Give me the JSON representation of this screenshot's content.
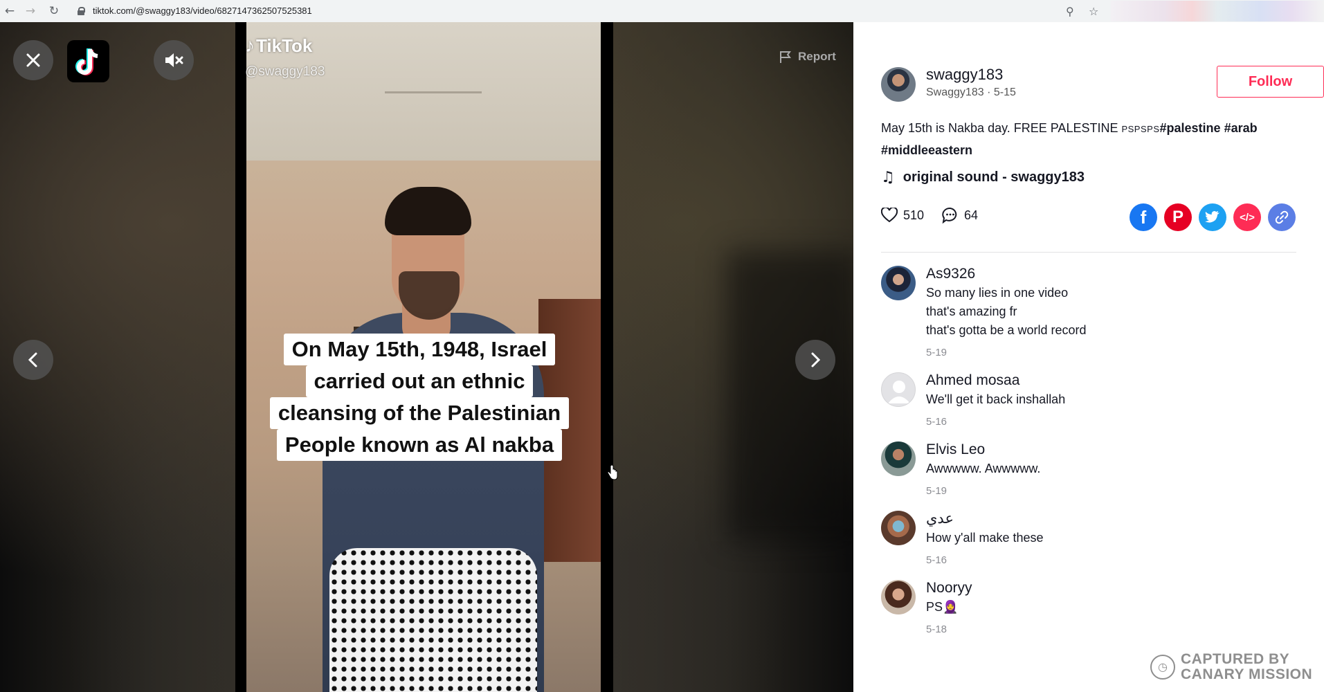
{
  "browser": {
    "url": "tiktok.com/@swaggy183/video/6827147362507525381"
  },
  "video": {
    "watermark_brand": "TikTok",
    "watermark_handle": "@swaggy183",
    "caption_lines": [
      "On May 15th, 1948,  Israel",
      "carried out an ethnic",
      "cleansing of the Palestinian",
      "People known as Al nakba"
    ],
    "report_label": "Report"
  },
  "post": {
    "author_username": "swaggy183",
    "author_meta": "Swaggy183 · 5-15",
    "follow_label": "Follow",
    "description_text": "May 15th is Nakba day. FREE PALESTINE ",
    "description_small": "PSPSPS",
    "hashtags": [
      "#palestine",
      "#arab",
      "#middleeastern"
    ],
    "sound": "original sound - swaggy183",
    "likes": "510",
    "comments_count": "64"
  },
  "share_colors": {
    "facebook": "#1877f2",
    "pinterest": "#e60023",
    "twitter": "#1da1f2",
    "embed": "#fe2c55",
    "link": "#5b7ee5"
  },
  "comments": [
    {
      "name": "As9326",
      "text": [
        "So many lies in one video",
        "that's amazing fr",
        "that's gotta be a world record"
      ],
      "date": "5-19"
    },
    {
      "name": "Ahmed mosaa",
      "text": [
        "We'll get it back inshallah"
      ],
      "date": "5-16"
    },
    {
      "name": "Elvis Leo",
      "text": [
        "Awwwww. Awwwww."
      ],
      "date": "5-19"
    },
    {
      "name": "عدي",
      "text": [
        "How y'all make these"
      ],
      "date": "5-16"
    },
    {
      "name": "Nooryy",
      "text": [
        "PS🧕"
      ],
      "date": "5-18"
    }
  ],
  "watermark": {
    "line1": "CAPTURED BY",
    "line2": "CANARY MISSION"
  }
}
